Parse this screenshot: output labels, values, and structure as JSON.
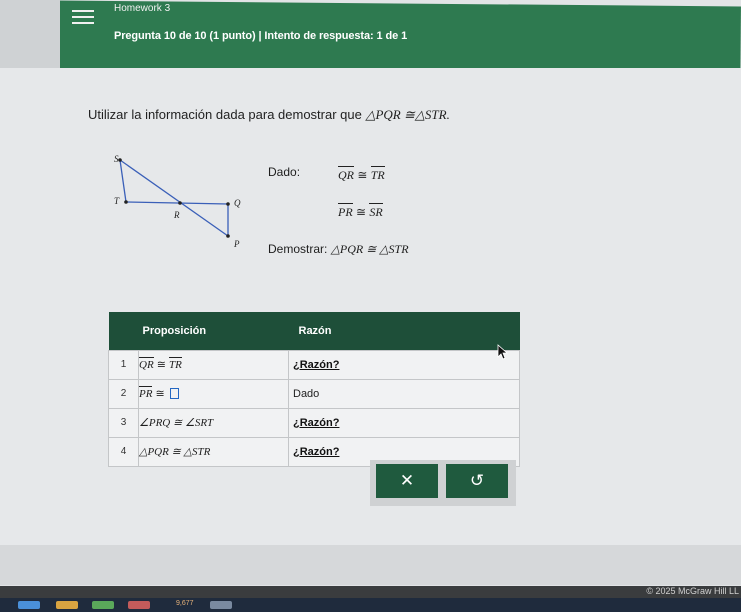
{
  "header": {
    "homework": "Homework 3",
    "question_info": "Pregunta 10 de 10 (1 punto)  |  Intento de respuesta: 1 de 1"
  },
  "problem": {
    "instruction": "Utilizar la información dada para demostrar que",
    "instruction_math": "△PQR ≅△STR.",
    "given_label": "Dado:",
    "given1_left": "QR",
    "given1_right": "TR",
    "given2_left": "PR",
    "given2_right": "SR",
    "congruent": "≅",
    "prove_label": "Demostrar:",
    "prove_math": "△PQR ≅ △STR"
  },
  "diagram": {
    "labels": {
      "S": "S",
      "T": "T",
      "Q": "Q",
      "R": "R",
      "P": "P"
    }
  },
  "table": {
    "header_statement": "Proposición",
    "header_reason": "Razón",
    "rows": [
      {
        "num": "1",
        "stmt_left": "QR",
        "stmt_right": "TR",
        "reason": "¿Razón?"
      },
      {
        "num": "2",
        "stmt_left": "PR",
        "stmt_right": "",
        "reason": "Dado"
      },
      {
        "num": "3",
        "stmt": "∠PRQ ≅ ∠SRT",
        "reason": "¿Razón?"
      },
      {
        "num": "4",
        "stmt": "△PQR ≅ △STR",
        "reason": "¿Razón?"
      }
    ]
  },
  "buttons": {
    "clear": "✕",
    "undo": "↺"
  },
  "footer": {
    "copyright": "© 2025 McGraw Hill LL"
  },
  "taskbar": {
    "label": "9,677"
  },
  "colors": {
    "header_green": "#2e7a50",
    "table_header": "#1e4f39",
    "button": "#1f5a3e"
  }
}
